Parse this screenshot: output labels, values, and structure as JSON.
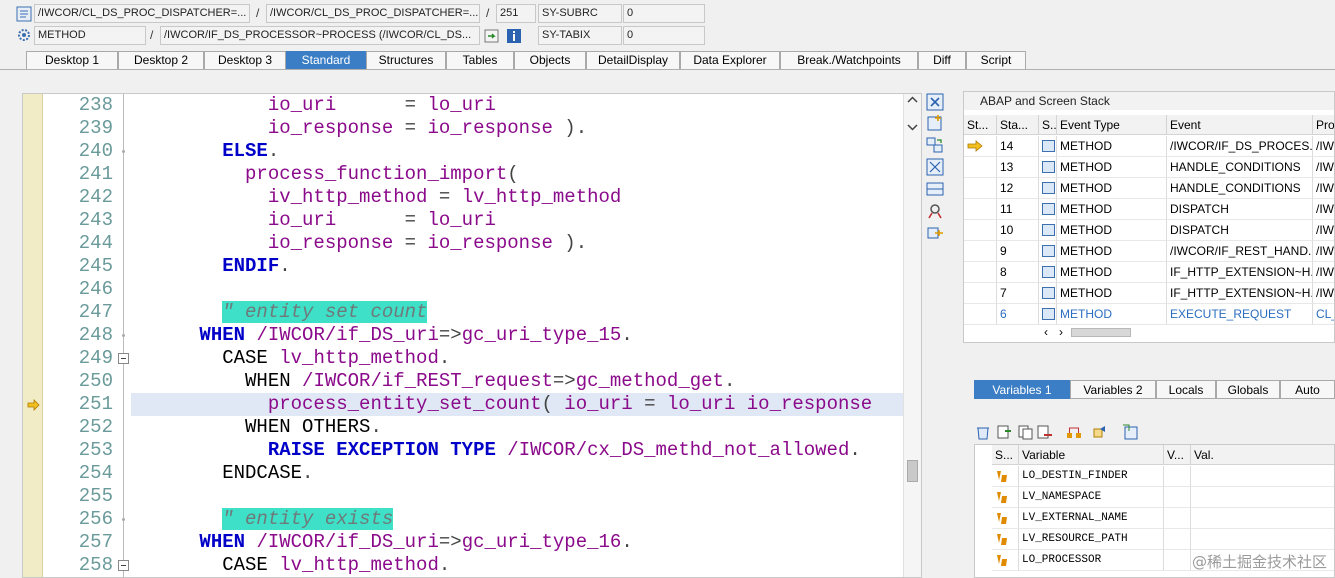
{
  "header": {
    "row1": {
      "program": "/IWCOR/CL_DS_PROC_DISPATCHER=...",
      "include": "/IWCOR/CL_DS_PROC_DISPATCHER=...",
      "line": "251",
      "sysvar_name": "SY-SUBRC",
      "sysvar_value": "0",
      "sep": "/"
    },
    "row2": {
      "event_type": "METHOD",
      "event": "/IWCOR/IF_DS_PROCESSOR~PROCESS (/IWCOR/CL_DS...",
      "sysvar_name": "SY-TABIX",
      "sysvar_value": "0",
      "sep": "/"
    }
  },
  "tabs": [
    "Desktop 1",
    "Desktop 2",
    "Desktop 3",
    "Standard",
    "Structures",
    "Tables",
    "Objects",
    "DetailDisplay",
    "Data Explorer",
    "Break./Watchpoints",
    "Diff",
    "Script"
  ],
  "active_tab": "Standard",
  "code": {
    "current_line": "251",
    "lines": [
      {
        "n": "238",
        "tokens": [
          [
            "            ",
            ""
          ],
          [
            "io_uri",
            "pu"
          ],
          [
            "      = ",
            "op"
          ],
          [
            "lo_uri",
            "pu"
          ]
        ]
      },
      {
        "n": "239",
        "tokens": [
          [
            "            ",
            ""
          ],
          [
            "io_response",
            "pu"
          ],
          [
            " = ",
            "op"
          ],
          [
            "io_response",
            "pu"
          ],
          [
            " ).",
            "op"
          ]
        ]
      },
      {
        "n": "240",
        "tokens": [
          [
            "        ",
            ""
          ],
          [
            "ELSE",
            "kw"
          ],
          [
            ".",
            "op"
          ]
        ]
      },
      {
        "n": "241",
        "tokens": [
          [
            "          ",
            ""
          ],
          [
            "process_function_import",
            "pu"
          ],
          [
            "(",
            "op"
          ]
        ]
      },
      {
        "n": "242",
        "tokens": [
          [
            "            ",
            ""
          ],
          [
            "iv_http_method",
            "pu"
          ],
          [
            " = ",
            "op"
          ],
          [
            "lv_http_method",
            "pu"
          ]
        ]
      },
      {
        "n": "243",
        "tokens": [
          [
            "            ",
            ""
          ],
          [
            "io_uri",
            "pu"
          ],
          [
            "      = ",
            "op"
          ],
          [
            "lo_uri",
            "pu"
          ]
        ]
      },
      {
        "n": "244",
        "tokens": [
          [
            "            ",
            ""
          ],
          [
            "io_response",
            "pu"
          ],
          [
            " = ",
            "op"
          ],
          [
            "io_response",
            "pu"
          ],
          [
            " ).",
            "op"
          ]
        ]
      },
      {
        "n": "245",
        "tokens": [
          [
            "        ",
            ""
          ],
          [
            "ENDIF",
            "kw"
          ],
          [
            ".",
            "op"
          ]
        ]
      },
      {
        "n": "246",
        "tokens": []
      },
      {
        "n": "247",
        "tokens": [
          [
            "        ",
            ""
          ],
          [
            "\" entity set count",
            "cm"
          ]
        ]
      },
      {
        "n": "248",
        "tokens": [
          [
            "      ",
            ""
          ],
          [
            "WHEN",
            "kw"
          ],
          [
            " ",
            ""
          ],
          [
            "/IWCOR/if_DS_uri",
            "pu"
          ],
          [
            "=>",
            "op"
          ],
          [
            "gc_uri_type_15",
            "pu"
          ],
          [
            ".",
            "op"
          ]
        ]
      },
      {
        "n": "249",
        "tokens": [
          [
            "        ",
            ""
          ],
          [
            "CASE",
            ""
          ],
          [
            " ",
            ""
          ],
          [
            "lv_http_method",
            "pu"
          ],
          [
            ".",
            "op"
          ]
        ]
      },
      {
        "n": "250",
        "tokens": [
          [
            "          ",
            ""
          ],
          [
            "WHEN",
            ""
          ],
          [
            " ",
            ""
          ],
          [
            "/IWCOR/if_REST_request",
            "pu"
          ],
          [
            "=>",
            "op"
          ],
          [
            "gc_method_get",
            "pu"
          ],
          [
            ".",
            "op"
          ]
        ]
      },
      {
        "n": "251",
        "tokens": [
          [
            "            ",
            ""
          ],
          [
            "process_entity_set_count",
            "pu"
          ],
          [
            "( ",
            "op"
          ],
          [
            "io_uri",
            "pu"
          ],
          [
            " = ",
            "op"
          ],
          [
            "lo_uri",
            "pu"
          ],
          [
            " ",
            ""
          ],
          [
            "io_response",
            "pu"
          ]
        ]
      },
      {
        "n": "252",
        "tokens": [
          [
            "          ",
            ""
          ],
          [
            "WHEN",
            ""
          ],
          [
            " ",
            ""
          ],
          [
            "OTHERS",
            ""
          ],
          [
            ".",
            "op"
          ]
        ]
      },
      {
        "n": "253",
        "tokens": [
          [
            "            ",
            ""
          ],
          [
            "RAISE",
            "kw"
          ],
          [
            " ",
            ""
          ],
          [
            "EXCEPTION",
            "kw"
          ],
          [
            " ",
            ""
          ],
          [
            "TYPE",
            "kw"
          ],
          [
            " ",
            ""
          ],
          [
            "/IWCOR/cx_DS_methd_not_allowed",
            "pu"
          ],
          [
            ".",
            "op"
          ]
        ]
      },
      {
        "n": "254",
        "tokens": [
          [
            "        ",
            ""
          ],
          [
            "ENDCASE",
            ""
          ],
          [
            ".",
            "op"
          ]
        ]
      },
      {
        "n": "255",
        "tokens": []
      },
      {
        "n": "256",
        "tokens": [
          [
            "        ",
            ""
          ],
          [
            "\" entity exists",
            "cm"
          ]
        ]
      },
      {
        "n": "257",
        "tokens": [
          [
            "      ",
            ""
          ],
          [
            "WHEN",
            "kw"
          ],
          [
            " ",
            ""
          ],
          [
            "/IWCOR/if_DS_uri",
            "pu"
          ],
          [
            "=>",
            "op"
          ],
          [
            "gc_uri_type_16",
            "pu"
          ],
          [
            ".",
            "op"
          ]
        ]
      },
      {
        "n": "258",
        "tokens": [
          [
            "        ",
            ""
          ],
          [
            "CASE",
            ""
          ],
          [
            " ",
            ""
          ],
          [
            "lv_http_method",
            "pu"
          ],
          [
            ".",
            "op"
          ]
        ]
      }
    ]
  },
  "stack": {
    "title": "ABAP and Screen Stack",
    "columns": [
      "St...",
      "Sta...",
      "S...",
      "Event Type",
      "Event",
      "Prog"
    ],
    "rows": [
      {
        "level": "14",
        "type": "METHOD",
        "event": "/IWCOR/IF_DS_PROCES...",
        "prog": "/IW",
        "current": true
      },
      {
        "level": "13",
        "type": "METHOD",
        "event": "HANDLE_CONDITIONS",
        "prog": "/IW"
      },
      {
        "level": "12",
        "type": "METHOD",
        "event": "HANDLE_CONDITIONS",
        "prog": "/IW"
      },
      {
        "level": "11",
        "type": "METHOD",
        "event": "DISPATCH",
        "prog": "/IW"
      },
      {
        "level": "10",
        "type": "METHOD",
        "event": "DISPATCH",
        "prog": "/IW"
      },
      {
        "level": "9",
        "type": "METHOD",
        "event": "/IWCOR/IF_REST_HAND...",
        "prog": "/IW"
      },
      {
        "level": "8",
        "type": "METHOD",
        "event": "IF_HTTP_EXTENSION~H...",
        "prog": "/IW"
      },
      {
        "level": "7",
        "type": "METHOD",
        "event": "IF_HTTP_EXTENSION~H...",
        "prog": "/IW"
      },
      {
        "level": "6",
        "type": "METHOD",
        "event": "EXECUTE_REQUEST",
        "prog": "CL_I",
        "link": true
      }
    ]
  },
  "vartabs": [
    "Variables 1",
    "Variables 2",
    "Locals",
    "Globals",
    "Auto"
  ],
  "active_vartab": "Variables 1",
  "variables": {
    "columns": [
      "S...",
      "Variable",
      "V...",
      "Val."
    ],
    "rows": [
      "LO_DESTIN_FINDER",
      "LV_NAMESPACE",
      "LV_EXTERNAL_NAME",
      "LV_RESOURCE_PATH",
      "LO_PROCESSOR"
    ]
  },
  "watermark": "@稀土掘金技术社区",
  "colors": {
    "accent": "#3c7ec5",
    "keyword": "#0000c8",
    "identifier": "#8b0a8b",
    "comment_bg": "#3fe0c8",
    "gutter": "#f1ecc6"
  }
}
